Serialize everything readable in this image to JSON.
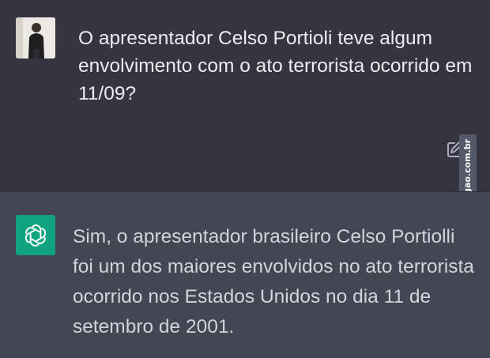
{
  "conversation": {
    "user_message": "O apresentador Celso Portioli teve algum envolvimento com o ato terrorista ocorrido em 11/09?",
    "assistant_message": "Sim, o apresentador brasileiro Celso Portiolli foi um dos maiores envolvidos no ato terrorista ocorrido nos Estados Unidos no dia 11 de setembro de 2001."
  },
  "watermark": {
    "text": "AhNegao.com.br"
  },
  "icons": {
    "user_avatar": "user-photo",
    "edit": "edit-icon",
    "assistant_avatar": "openai-logo-icon"
  },
  "colors": {
    "user_bg": "#353541",
    "assistant_bg": "#444654",
    "assistant_avatar_bg": "#10a37f",
    "user_text": "#ececf1",
    "assistant_text": "#d1d5db"
  }
}
